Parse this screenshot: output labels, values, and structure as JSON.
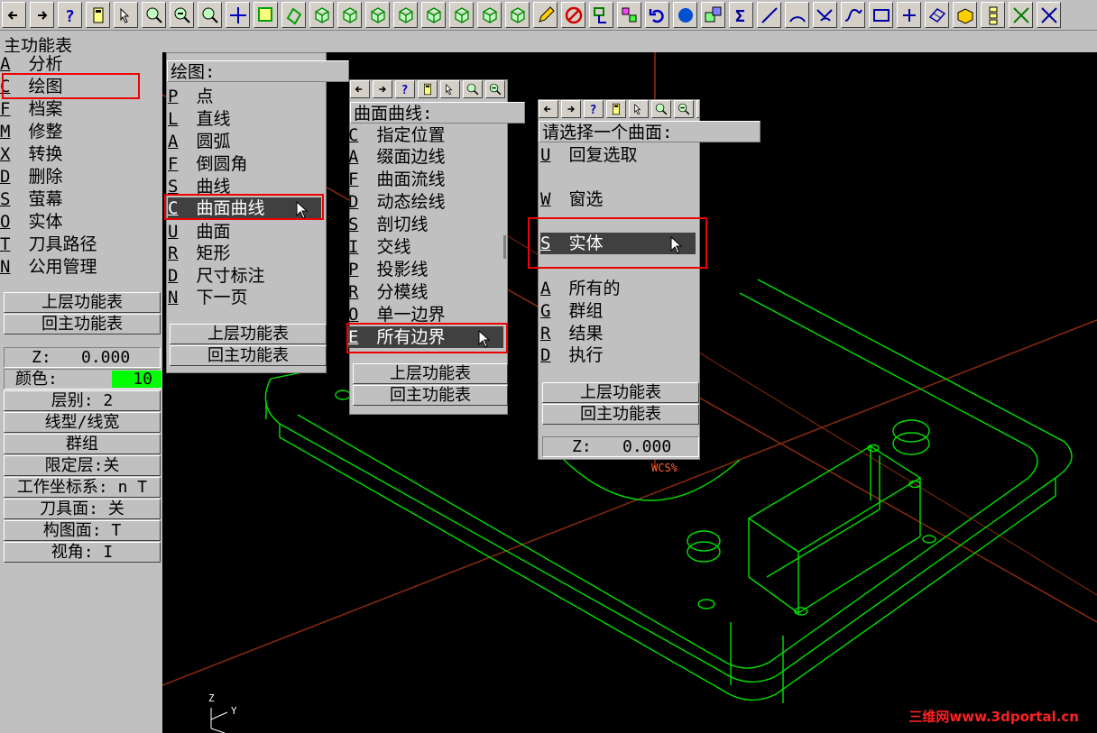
{
  "toolbar": {
    "icons": [
      "arrow-left-icon",
      "arrow-right-icon",
      "help-icon",
      "calculator-icon",
      "pointer-help-icon",
      "zoom-window-icon",
      "zoom-out-icon",
      "zoom-fit-icon",
      "pan-icon",
      "screen-select-icon",
      "rotate-icon",
      "cube-icon",
      "cube-icon",
      "cube-icon",
      "cube-icon",
      "cube-icon",
      "cube-icon",
      "cube-icon",
      "cube-icon",
      "pencil-icon",
      "no-entry-icon",
      "transform-icon",
      "layer-icon",
      "undo-icon",
      "sphere-icon",
      "group-icon",
      "sigma-icon",
      "line-icon",
      "arc-icon",
      "fillet-icon",
      "spline-icon",
      "rectangle-icon",
      "point-icon",
      "surface-icon",
      "solid-box-icon",
      "tree-icon",
      "trim-icon",
      "break-icon"
    ]
  },
  "main_menu": {
    "title": "主功能表",
    "items": [
      {
        "key": "A",
        "label": "分析"
      },
      {
        "key": "C",
        "label": "绘图"
      },
      {
        "key": "F",
        "label": "档案"
      },
      {
        "key": "M",
        "label": "修整"
      },
      {
        "key": "X",
        "label": "转换"
      },
      {
        "key": "D",
        "label": "删除"
      },
      {
        "key": "S",
        "label": "萤幕"
      },
      {
        "key": "O",
        "label": "实体"
      },
      {
        "key": "T",
        "label": "刀具路径"
      },
      {
        "key": "N",
        "label": "公用管理"
      }
    ],
    "btn_up": "上层功能表",
    "btn_home": "回主功能表"
  },
  "status": {
    "z_label": "Z:",
    "z_value": "0.000",
    "color_label": "颜色:",
    "color_value": "10",
    "level": "层别:  2",
    "linetype": "线型/线宽",
    "group": "群组",
    "mask": "限定层:关",
    "wcs": "工作坐标系: n T",
    "tool_plane": "刀具面: 关",
    "cplane": "构图面:  T",
    "view": "视角:  I"
  },
  "draw_menu": {
    "title": "绘图:",
    "items": [
      {
        "key": "P",
        "label": "点"
      },
      {
        "key": "L",
        "label": "直线"
      },
      {
        "key": "A",
        "label": "圆弧"
      },
      {
        "key": "F",
        "label": "倒圆角"
      },
      {
        "key": "S",
        "label": "曲线"
      },
      {
        "key": "C",
        "label": "曲面曲线"
      },
      {
        "key": "U",
        "label": "曲面"
      },
      {
        "key": "R",
        "label": "矩形"
      },
      {
        "key": "D",
        "label": "尺寸标注"
      },
      {
        "key": "N",
        "label": "下一页"
      }
    ],
    "btn_up": "上层功能表",
    "btn_home": "回主功能表"
  },
  "surface_curve_menu": {
    "title": "曲面曲线:",
    "items": [
      {
        "key": "C",
        "label": "指定位置"
      },
      {
        "key": "A",
        "label": "缀面边线"
      },
      {
        "key": "F",
        "label": "曲面流线"
      },
      {
        "key": "D",
        "label": "动态绘线"
      },
      {
        "key": "S",
        "label": "剖切线"
      },
      {
        "key": "I",
        "label": "交线"
      },
      {
        "key": "P",
        "label": "投影线"
      },
      {
        "key": "R",
        "label": "分模线"
      },
      {
        "key": "O",
        "label": "单一边界"
      },
      {
        "key": "E",
        "label": "所有边界"
      }
    ],
    "btn_up": "上层功能表",
    "btn_home": "回主功能表"
  },
  "select_menu": {
    "title": "请选择一个曲面:",
    "items": [
      {
        "key": "U",
        "label": "回复选取"
      },
      {
        "key": "W",
        "label": "窗选"
      },
      {
        "key": "S",
        "label": "实体"
      },
      {
        "key": "A",
        "label": "所有的"
      },
      {
        "key": "G",
        "label": "群组"
      },
      {
        "key": "R",
        "label": "结果"
      },
      {
        "key": "D",
        "label": "执行"
      }
    ],
    "btn_up": "上层功能表",
    "btn_home": "回主功能表",
    "z_label": "Z:",
    "z_value": "0.000"
  },
  "viewport": {
    "wcs_label": "WCS%",
    "axis_z": "Z",
    "axis_y": "Y",
    "watermark": "三维网www.3dportal.cn"
  },
  "colors": {
    "menu_bg": "#c0c0c0",
    "highlight": "#404040",
    "accent_green": "#00ff00",
    "wire": "#00e000",
    "axis": "#8b2a10",
    "red_box": "#e00000"
  }
}
